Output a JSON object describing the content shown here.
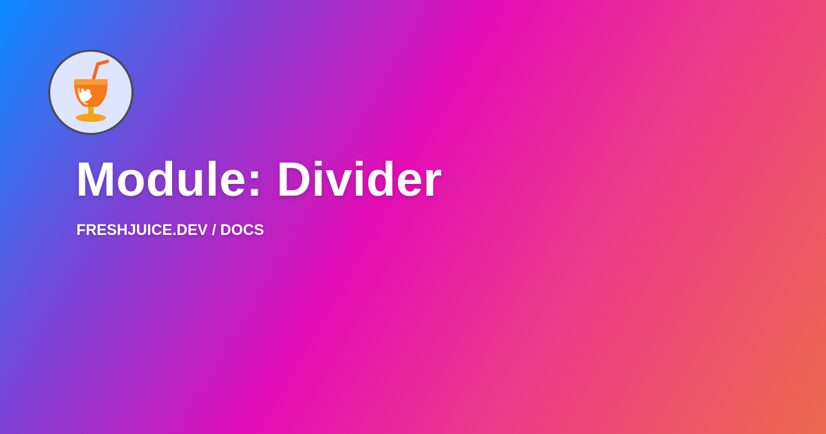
{
  "card": {
    "title": "Module: Divider",
    "breadcrumb": "FRESHJUICE.DEV / DOCS",
    "logo_icon": "juice-glass-icon"
  },
  "colors": {
    "gradient": [
      "#0a8cff",
      "#7a45d6",
      "#e30db6",
      "#ec3a8a",
      "#ed6a4c"
    ],
    "text": "#ffffff",
    "logo_background": "#dfe4ff",
    "logo_border": "#4a4a55",
    "juice_orange": "#f57a1a"
  }
}
